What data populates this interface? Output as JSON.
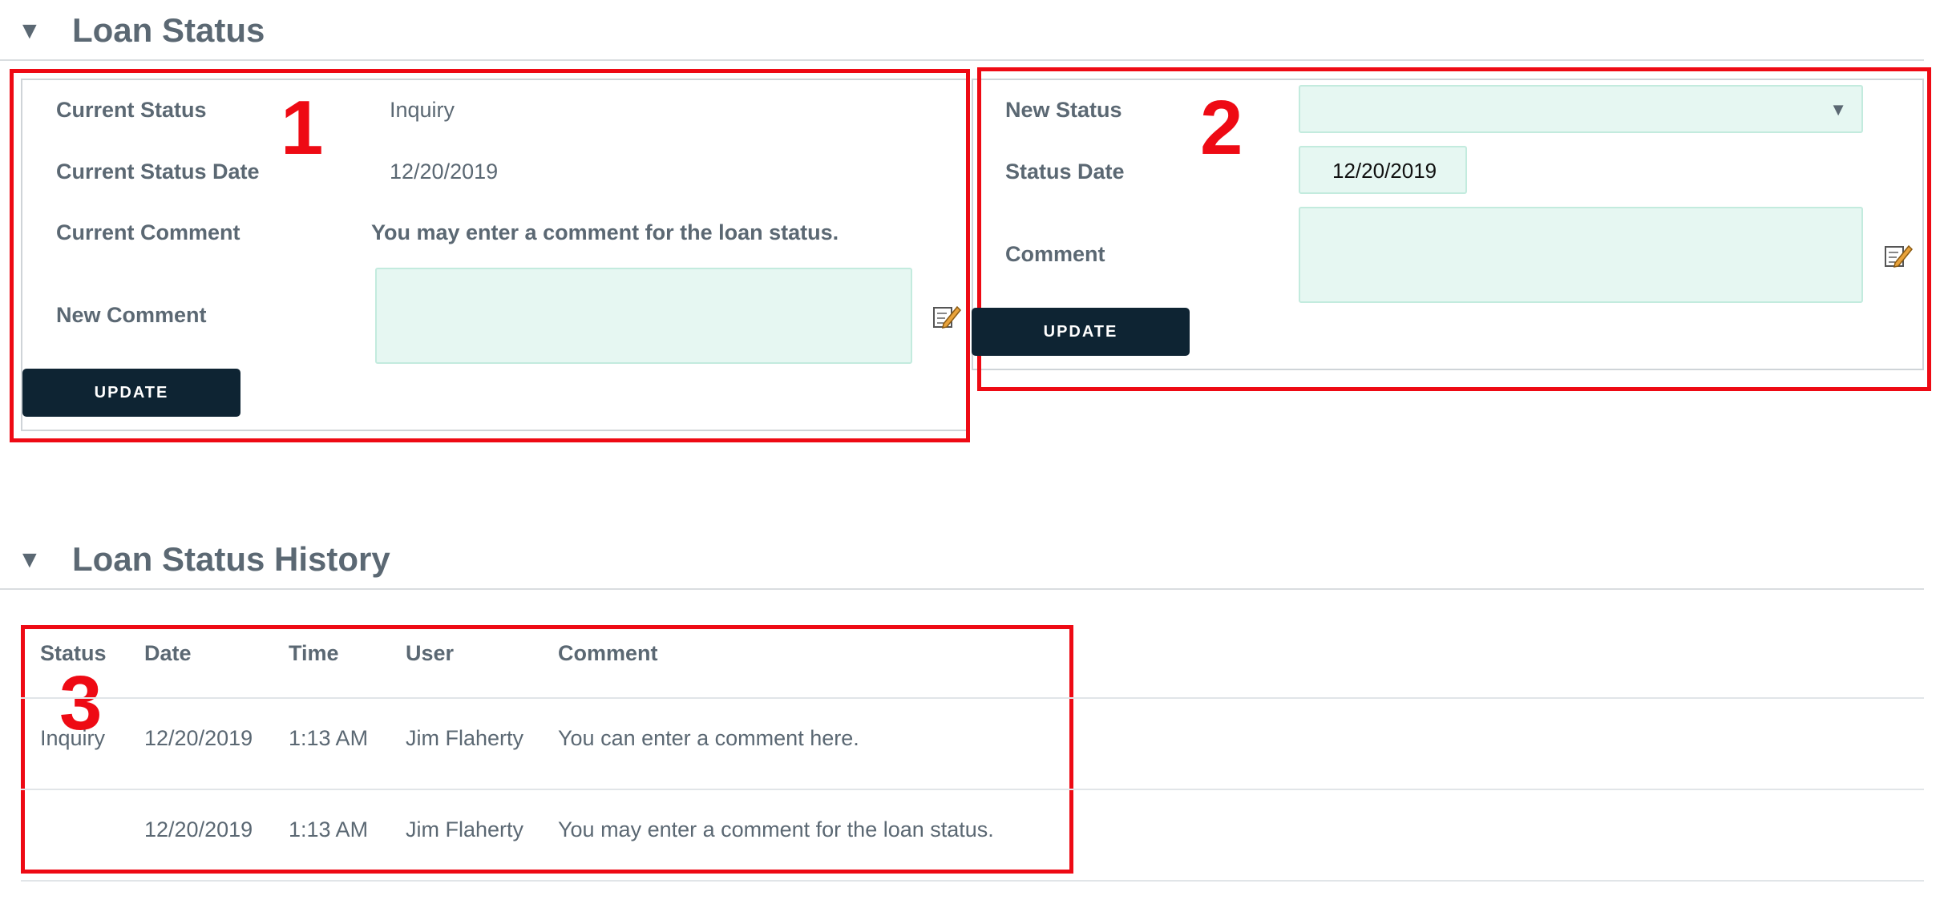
{
  "loan_status": {
    "title": "Loan Status",
    "current": {
      "status_label": "Current Status",
      "status_value": "Inquiry",
      "date_label": "Current Status Date",
      "date_value": "12/20/2019",
      "comment_label": "Current Comment",
      "comment_value": "You may enter a comment for the loan status.",
      "new_comment_label": "New Comment",
      "new_comment_value": "",
      "update_label": "UPDATE"
    },
    "new": {
      "status_label": "New Status",
      "status_value": "",
      "date_label": "Status Date",
      "date_value": "12/20/2019",
      "comment_label": "Comment",
      "comment_value": "",
      "update_label": "UPDATE"
    }
  },
  "history": {
    "title": "Loan Status History",
    "columns": [
      "Status",
      "Date",
      "Time",
      "User",
      "Comment"
    ],
    "rows": [
      {
        "status": "Inquiry",
        "date": "12/20/2019",
        "time": "1:13 AM",
        "user": "Jim Flaherty",
        "comment": "You can enter a comment here."
      },
      {
        "status": "",
        "date": "12/20/2019",
        "time": "1:13 AM",
        "user": "Jim Flaherty",
        "comment": "You may enter a comment for the loan status."
      }
    ]
  },
  "annotations": [
    "1",
    "2",
    "3"
  ],
  "colors": {
    "accent_red": "#ee0a14",
    "button_dark": "#0e2433",
    "field_bg": "#e6f7f2",
    "text": "#5b6873"
  }
}
